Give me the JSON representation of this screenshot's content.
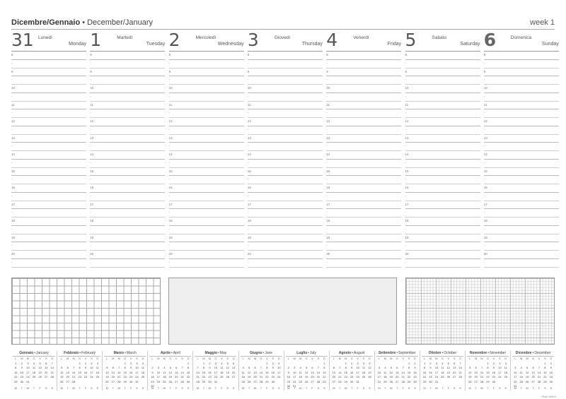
{
  "header": {
    "title_it": "Dicembre/Gennaio",
    "separator": "•",
    "title_en": "December/January",
    "week": "week 1"
  },
  "days": [
    {
      "num": "31",
      "it": "Lunedì",
      "en": "Monday"
    },
    {
      "num": "1",
      "it": "Martedì",
      "en": "Tuesday"
    },
    {
      "num": "2",
      "it": "Mercoledì",
      "en": "Wednesday"
    },
    {
      "num": "3",
      "it": "Giovedì",
      "en": "Thursday"
    },
    {
      "num": "4",
      "it": "Venerdì",
      "en": "Friday"
    },
    {
      "num": "5",
      "it": "Sabato",
      "en": "Saturday"
    },
    {
      "num": "6",
      "it": "Domenica",
      "en": "Sunday"
    }
  ],
  "hours": [
    "8",
    "9",
    "10",
    "11",
    "12",
    "13",
    "14",
    "15",
    "16",
    "17",
    "18",
    "19",
    "20"
  ],
  "half_hour_mark": "-",
  "weekday_initials": [
    "L",
    "M",
    "M",
    "G",
    "V",
    "S",
    "D"
  ],
  "weekday_initials_en": [
    "M",
    "T",
    "W",
    "T",
    "F",
    "S",
    "S"
  ],
  "months": [
    {
      "it": "Gennaio",
      "en": "January",
      "start": 0,
      "days": 31
    },
    {
      "it": "Febbraio",
      "en": "February",
      "start": 3,
      "days": 28
    },
    {
      "it": "Marzo",
      "en": "March",
      "start": 3,
      "days": 31
    },
    {
      "it": "Aprile",
      "en": "April",
      "start": 6,
      "days": 30
    },
    {
      "it": "Maggio",
      "en": "May",
      "start": 1,
      "days": 31
    },
    {
      "it": "Giugno",
      "en": "June",
      "start": 4,
      "days": 30
    },
    {
      "it": "Luglio",
      "en": "July",
      "start": 6,
      "days": 31
    },
    {
      "it": "Agosto",
      "en": "August",
      "start": 2,
      "days": 31
    },
    {
      "it": "Settembre",
      "en": "September",
      "start": 5,
      "days": 30
    },
    {
      "it": "Ottobre",
      "en": "October",
      "start": 0,
      "days": 31
    },
    {
      "it": "Novembre",
      "en": "November",
      "start": 3,
      "days": 30
    },
    {
      "it": "Dicembre",
      "en": "December",
      "start": 5,
      "days": 31
    }
  ],
  "product_code": "PA46-1999-9"
}
